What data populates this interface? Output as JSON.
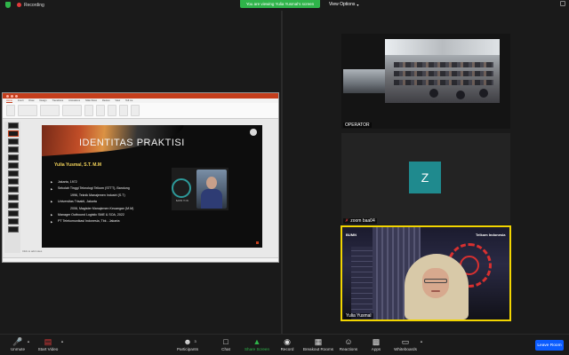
{
  "top_bar": {
    "recording_label": "Recording",
    "viewing_banner": "You are viewing Yulia Yusmal's screen",
    "view_options_label": "View Options"
  },
  "shared_screen": {
    "ppt_tabs": [
      "Home",
      "Insert",
      "Draw",
      "Design",
      "Transitions",
      "Animations",
      "Slide Show",
      "Review",
      "View",
      "Tell me"
    ],
    "slide": {
      "title": "IDENTITAS PRAKTISI",
      "name": "Yulia Yusmal, S.T. M.M",
      "items": [
        {
          "text": "Jakarta, 1972",
          "bullet": true,
          "indent": false
        },
        {
          "text": "Sekolah Tinggi Teknologi Telkom (STTT), Bandung",
          "bullet": true,
          "indent": false
        },
        {
          "text": "1996, Teknik Manajemen Industri (S.T)",
          "bullet": false,
          "indent": true
        },
        {
          "text": "Universitas Trisakti, Jakarta",
          "bullet": true,
          "indent": false
        },
        {
          "text": "2006, Magister Manajemen Keuangan (M.M)",
          "bullet": false,
          "indent": true
        },
        {
          "text": "Manager Outbound Logistic SME & SOA, 2022",
          "bullet": true,
          "indent": false
        },
        {
          "text": "PT Telekomunikasi Indonesia, Tbk - Jakarta",
          "bullet": true,
          "indent": false
        }
      ],
      "photo_caption": "BARIS IT ON"
    },
    "notes_placeholder": "Click to add notes"
  },
  "participants": {
    "operator_label": "OPERATOR",
    "zoom_tile": {
      "avatar_initial": "Z",
      "label": "zoom baa04"
    },
    "speaker_label": "Yulia Yusmal",
    "speaker_brands": [
      "BUMN",
      "Telkom Indonesia"
    ]
  },
  "toolbar": {
    "unmute_label": "Unmute",
    "start_video_label": "Start Video",
    "participants_label": "Participants",
    "participants_count": "3",
    "chat_label": "Chat",
    "share_screen_label": "Share Screen",
    "record_label": "Record",
    "breakout_label": "Breakout Rooms",
    "reactions_label": "Reactions",
    "apps_label": "Apps",
    "whiteboards_label": "Whiteboards",
    "leave_label": "Leave Room"
  },
  "colors": {
    "accent_green": "#2fb44a",
    "leave_blue": "#0b5cff",
    "avatar_teal": "#1f8a8e",
    "active_speaker_yellow": "#f2d500"
  }
}
